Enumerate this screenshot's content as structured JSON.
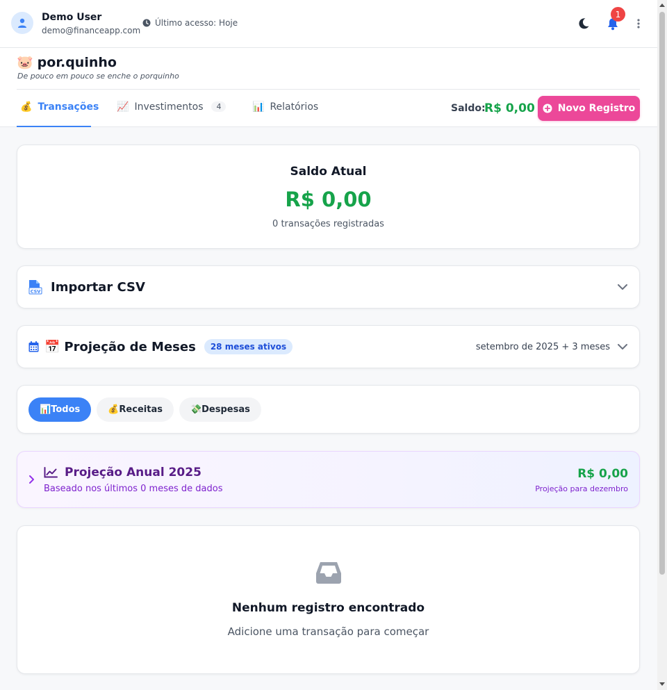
{
  "user": {
    "name": "Demo User",
    "email": "demo@financeapp.com",
    "last_access": "Último acesso: Hoje"
  },
  "notifications": {
    "count": "1"
  },
  "brand": {
    "emoji": "🐷",
    "name": "por.quinho",
    "tagline": "De pouco em pouco se enche o porquinho"
  },
  "tabs": [
    {
      "emoji": "💰",
      "label": "Transações",
      "active": true
    },
    {
      "emoji": "📈",
      "label": "Investimentos",
      "count": "4"
    },
    {
      "emoji": "📊",
      "label": "Relatórios"
    }
  ],
  "header": {
    "saldo_label": "Saldo:",
    "saldo_value": "R$ 0,00",
    "new_button": "Novo Registro"
  },
  "balance": {
    "title": "Saldo Atual",
    "value": "R$ 0,00",
    "subtitle": "0 transações registradas"
  },
  "import_csv": {
    "title": "Importar CSV"
  },
  "months": {
    "emoji": "📅",
    "title": "Projeção de Meses",
    "badge": "28 meses ativos",
    "range": "setembro de 2025 + 3 meses"
  },
  "filters": [
    {
      "emoji": "📊",
      "label": "Todos",
      "active": true
    },
    {
      "emoji": "💰",
      "label": "Receitas"
    },
    {
      "emoji": "💸",
      "label": "Despesas"
    }
  ],
  "annual_projection": {
    "title": "Projeção Anual 2025",
    "subtitle": "Baseado nos últimos 0 meses de dados",
    "value": "R$ 0,00",
    "caption": "Projeção para dezembro"
  },
  "empty_state": {
    "title": "Nenhum registro encontrado",
    "subtitle": "Adicione uma transação para começar"
  },
  "colors": {
    "accent": "#3b82f6",
    "primary_button": "#ec4899",
    "positive": "#16a34a",
    "purple": "#581c87",
    "notification": "#ef4444"
  },
  "icons": {
    "avatar": "user-icon",
    "last_access": "clock-icon",
    "theme": "moon-icon",
    "notifications": "bell-icon",
    "menu": "kebab-menu-icon",
    "csv": "csv-file-icon",
    "calendar": "calendar-icon",
    "trend": "line-chart-icon",
    "empty": "inbox-icon"
  }
}
